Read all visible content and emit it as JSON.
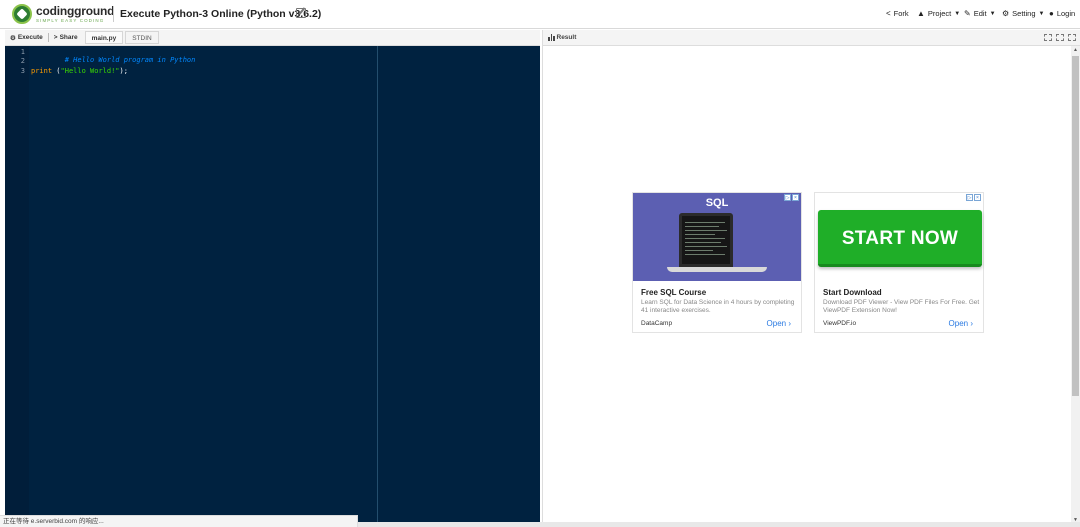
{
  "header": {
    "logo_name": "codingground",
    "logo_tagline": "SIMPLY EASY CODING",
    "title": "Execute Python-3 Online (Python v3.6.2)",
    "menu": [
      {
        "label": "Fork",
        "icon": "share-icon"
      },
      {
        "label": "Project",
        "icon": "sitemap-icon"
      },
      {
        "label": "Edit",
        "icon": "edit-icon"
      },
      {
        "label": "Setting",
        "icon": "gear-icon"
      },
      {
        "label": "Login",
        "icon": "user-icon"
      }
    ]
  },
  "editor": {
    "toolbar": {
      "execute_label": "Execute",
      "share_label": "Share",
      "tabs": [
        "main.py",
        "STDIN"
      ]
    },
    "lines": [
      {
        "num": "1",
        "text": "# Hello World program in Python"
      },
      {
        "num": "2",
        "text": ""
      },
      {
        "num": "3",
        "text": "print (\"Hello World!\");"
      }
    ],
    "code_parts": {
      "comment": "# Hello World program in Python",
      "keyword": "print",
      "open": " (",
      "string": "\"Hello World!\"",
      "close": ");"
    }
  },
  "result": {
    "label": "Result"
  },
  "ads": [
    {
      "visual_text": "SQL",
      "title": "Free SQL Course",
      "description": "Learn SQL for Data Science in 4 hours by completing 41 interactive exercises.",
      "source": "DataCamp",
      "cta": "Open"
    },
    {
      "visual_text": "START NOW",
      "title": "Start Download",
      "description": "Download PDF Viewer - View PDF Files For Free. Get ViewPDF Extension Now!",
      "source": "ViewPDF.io",
      "cta": "Open"
    }
  ],
  "status": {
    "text": "正在等待 e.serverbid.com 的响应..."
  },
  "colors": {
    "editor_bg": "#002240",
    "comment": "#0088ff",
    "keyword": "#ff9d00",
    "string": "#3ad900",
    "start_button": "#1fae28",
    "sql_ad_bg": "#5c5fb2",
    "link": "#2a7ae2"
  }
}
